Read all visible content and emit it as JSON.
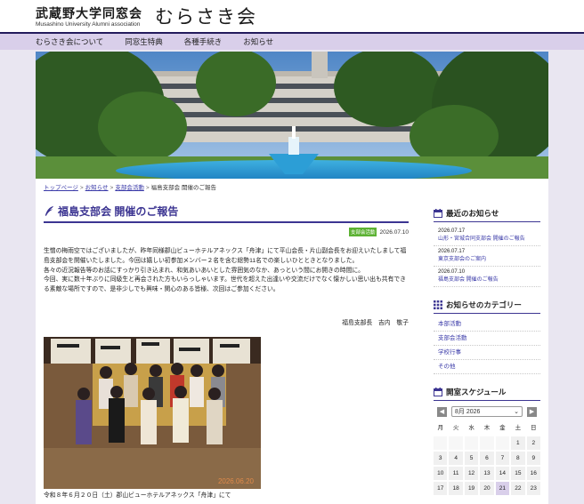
{
  "header": {
    "logo_jp": "武蔵野大学同窓会",
    "logo_en": "Musashino University Alumni association",
    "logo_main": "むらさき会"
  },
  "nav": [
    "むらさき会について",
    "同窓生特典",
    "各種手続き",
    "お知らせ"
  ],
  "breadcrumb": {
    "items": [
      "トップページ",
      "お知らせ",
      "支部会活動"
    ],
    "current": "福島支部会 開催のご報告",
    "sep": ">"
  },
  "article": {
    "title": "福島支部会 開催のご報告",
    "badge": "支部会活動",
    "date": "2026.07.10",
    "paragraphs": [
      "生憎の梅雨空ではございましたが、昨年同様郡山ビューホテルアネックス「舟津」にて平山会長・片山副会長をお迎えいたしまして福島支部会を開催いたしました。今回は嬉しい初参加メンバー２名を含む総勢11名での楽しいひとときとなりました。",
      "各々の近況報告等のお話にすっかり引き込まれ、和気あいあいとした雰囲気のなか、あっという間にお開きの時間に。",
      "今回、実に数十年ぶりに同級生と再会された方もいらっしゃいます。世代を超えた出逢いや交流だけでなく懐かしい思い出も共有できる素敵な場所ですので、是非少しでも興味・関心のある皆様、次回はご参加ください。"
    ],
    "signature": "福島支部長　吉内　敬子",
    "photo_stamp": "2026.06.20",
    "caption": "令和８年６月２０日（土）郡山ビューホテルアネックス「舟津」にて"
  },
  "sidebar": {
    "news_title": "最近のお知らせ",
    "news": [
      {
        "date": "2026.07.17",
        "title": "山形・宮城合同支部会 開催のご報告"
      },
      {
        "date": "2026.07.17",
        "title": "東京支部会のご案内"
      },
      {
        "date": "2026.07.10",
        "title": "福島支部会 開催のご報告"
      }
    ],
    "cat_title": "お知らせのカテゴリー",
    "categories": [
      "本部活動",
      "支部会活動",
      "学校行事",
      "その他"
    ],
    "cal_title": "開室スケジュール",
    "cal_month": "8月 2026",
    "cal_prev": "◀",
    "cal_next": "▶",
    "weekdays": [
      "月",
      "火",
      "水",
      "木",
      "金",
      "土",
      "日"
    ],
    "days": [
      "",
      "",
      "",
      "",
      "",
      "1",
      "2",
      "3",
      "4",
      "5",
      "6",
      "7",
      "8",
      "9",
      "10",
      "11",
      "12",
      "13",
      "14",
      "15",
      "16",
      "17",
      "18",
      "19",
      "20",
      "21",
      "22",
      "23"
    ],
    "today": "21"
  },
  "colors": {
    "accent": "#3c3592",
    "nav_bg": "#d9cfea",
    "badge": "#5cb233",
    "link": "#3a3aa8"
  }
}
